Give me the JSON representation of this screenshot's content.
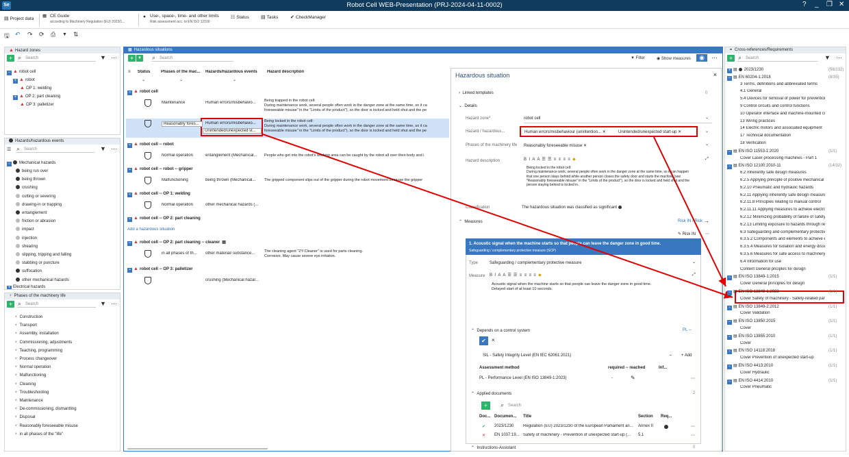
{
  "window": {
    "title": "Robot Cell WEB-Presentation (PRJ-2024-04-11-0002)",
    "logo": "Se",
    "controls": [
      "?",
      "_",
      "❐",
      "✕"
    ]
  },
  "ribbon": {
    "tabs": [
      {
        "label": "Project data",
        "sub": "",
        "icon": "project-icon"
      },
      {
        "label": "CE Guide",
        "sub": "according to Machinery Regulation (EU) 2023/1...",
        "icon": "ce-icon"
      },
      {
        "label": "Use-, space-, time- and other limits",
        "sub": "Risk assessment acc. to EN ISO 12100",
        "icon": "limits-icon"
      },
      {
        "label": "Status",
        "sub": "",
        "icon": "status-icon"
      },
      {
        "label": "Tasks",
        "sub": "",
        "icon": "tasks-icon"
      },
      {
        "label": "CheckManager",
        "sub": "",
        "icon": "check-icon"
      }
    ]
  },
  "hazard_zones": {
    "title": "Hazard zones",
    "search": "Search",
    "items": [
      {
        "label": "robot cell"
      },
      {
        "label": "robot"
      },
      {
        "label": "OP 1: welding"
      },
      {
        "label": "OP 2: part cleaning"
      },
      {
        "label": "OP 3: palletizer"
      }
    ]
  },
  "hazard_events": {
    "title": "Hazards/hazardous events",
    "search": "Search",
    "root": "Mechanical hazards",
    "items": [
      "being run over",
      "being thrown",
      "crushing",
      "cutting or severing",
      "drawing-in or trapping",
      "entanglement",
      "friction or abrasion",
      "impact",
      "injection",
      "shearing",
      "slipping, tripping and falling",
      "stabbing or puncture",
      "suffocation",
      "other mechanical hazards"
    ],
    "next": "Electrical hazards"
  },
  "phases": {
    "title": "Phases of the machinery life",
    "search": "Search",
    "items": [
      "Construction",
      "Transport",
      "Assembly,  installation",
      "Commissioning, adjustments",
      "Teaching, programming",
      "Process changeover",
      "Normal operation",
      "Malfunctioning",
      "Cleaning",
      "Troubleshooting",
      "Maintenance",
      "De-commissioning, dismantling",
      "Disposal",
      "Reasonably foreseeable misuse",
      "in all phases of the \"life\""
    ]
  },
  "situations": {
    "title": "Hazardous situations",
    "search": "Search",
    "filter": "Filter",
    "show_measures": "Show measures",
    "columns": [
      "Status",
      "Phases of the mac...",
      "Hazards/hazardous events",
      "Hazard description"
    ],
    "groups": [
      {
        "label": "robot cell"
      },
      {
        "label": "robot cell -- robot"
      },
      {
        "label": "robot cell -- robot -- gripper"
      },
      {
        "label": "robot cell -- OP 1: welding"
      },
      {
        "label": "robot cell -- OP 2: part cleaning"
      },
      {
        "label": "robot cell -- OP 2: part cleaning -- cleaner"
      },
      {
        "label": "robot cell -- OP 3: palletizer"
      }
    ],
    "rows": [
      {
        "phase": "Maintenance",
        "hazard": "Human errors/misbehavio...",
        "desc": [
          "Being trapped in the robot cell:",
          "During maintenance work, several people often work in the danger zone at the same time, so it ca",
          "foreseeable misuse\" in the \"Limits of the product\"), so the door is locked and held shut and the pe"
        ]
      },
      {
        "phase": "Reasonably fores...",
        "hazard": "Human errors/misbehavio...",
        "hazard2": "Unintended/unexpected st...",
        "desc": [
          "Being locked in the robot cell:",
          "During maintenance work, several people often work in the danger zone at the same time, so it ca",
          "foreseeable misuse\" in the \"Limits of the product\"), so the door is locked and held shut and the pe"
        ]
      },
      {
        "phase": "Normal operation",
        "hazard": "entanglement (Mechanical...",
        "desc": [
          "People who get into the robot's working area can be caught by the robot all over their body and i"
        ]
      },
      {
        "phase": "Malfunctioning",
        "hazard": "being thrown (Mechanical...",
        "desc": [
          "The gripped component slips out of the gripper during the robot movement because the gripper"
        ]
      },
      {
        "phase": "Normal operation",
        "hazard": "other mechanical hazards (...",
        "desc": []
      },
      {
        "phase": "in all phases of th...",
        "hazard": "other material/ substance...",
        "desc": [
          "The cleaning agent \"ZY-Cleaner\" is used for parts cleaning.",
          "Corrosive. May cause severe eye irritation."
        ]
      },
      {
        "phase": "",
        "hazard": "crushing (Mechanical hazar...",
        "desc": []
      }
    ],
    "add_link": "Add a hazardous situation"
  },
  "detail": {
    "title": "Hazardous situation",
    "linked": "Linked templates",
    "details": "Details",
    "zone_label": "Hazard zone*",
    "zone_value": "robot cell",
    "hazard_label": "Hazard / hazardous...",
    "hazard_chips": [
      "Human errors/misbehaviour (unintention...",
      "Unintended/unexpected start-up"
    ],
    "phase_label": "Phases of the machinery life",
    "phase_value": "Reasonably foreseeable misuse",
    "desc_label": "Hazard description",
    "desc_lines": [
      "Being locked in the robot cell:",
      "During maintenance work, several people often work in the danger zone at the same time, so it can happen",
      "that one person stays behind while another person closes the safety door and starts the machine (see",
      "\"Reasonably foreseeable misuse\" in the \"Limits of the product\"), so the door is locked and held shut and the",
      "person staying behind is locked in."
    ],
    "class_label": "Classification",
    "class_value": "The hazardous situation was classified as significant",
    "measures": "Measures",
    "risk_in": "Risk IN / Risk",
    "risk_btn": "Risk IN",
    "measure_title": "1. Acoustic signal when the machine starts so that people can leave the danger zone in good time.",
    "measure_sub": "Safeguarding / complementary protective measure (SCP)",
    "type_label": "Type",
    "type_value": "Safeguarding / complementary protective measure",
    "measure_label": "Measure",
    "measure_text": [
      "Acoustic signal when the machine starts so that people can leave the danger zone in good time.",
      "Delayed start of at least 10 seconds."
    ],
    "control_label": "Depends on a control system",
    "pl_badge": "PL --",
    "sil": "SIL - Safety Integrity Level (EN IEC 62061:2021)",
    "add": "Add",
    "assess_cols": [
      "Assessment method",
      "required -- reached",
      "Inf..."
    ],
    "assess_row": "PL - Performance Level (EN ISO 13849-1:2023)",
    "assess_req": "-",
    "applied_docs": "Applied documents",
    "applied_count": "2",
    "doc_search": "Search",
    "doc_cols": [
      "Doc...",
      "Documen...",
      "Title",
      "Section",
      "Req..."
    ],
    "docs": [
      {
        "doc": "2023/1230",
        "title": "Regulation (EU) 2023/1230 of the European Parliament an...",
        "section": "Annex II"
      },
      {
        "doc": "EN 1037:19...",
        "title": "Safety of machinery - Prevention of unexpected start-up (...",
        "section": "5.1"
      }
    ],
    "instructions": "Instructions-Assistant"
  },
  "xref": {
    "title": "Cross-references/Requirements",
    "search": "Search",
    "items": [
      {
        "label": "2023/1230",
        "count": "(58/132)",
        "subs": []
      },
      {
        "label": "EN 60204-1:2018",
        "count": "(8/35)",
        "subs": [
          "3 Terms, definitions and abbreviated terms",
          "4.1 General",
          "5.4 Devices for removal of power for prevention of u...",
          "9 Control circuits and control functions",
          "10 Operator interface and machine-mounted contro...",
          "13 Wiring practices",
          "14 Electric motors and associated equipment",
          "17 Technical documentation",
          "18 Verification"
        ]
      },
      {
        "label": "EN ISO 11553-1:2020",
        "count": "(1/1)",
        "subs": [
          "Cover Laser processing machines - Part 1"
        ]
      },
      {
        "label": "EN ISO 12100:2010-11",
        "count": "(14/32)",
        "subs": [
          "6.2 Inherently safe design measures",
          "6.2.5 Applying principle of positive mechanical action",
          "6.2.10 Pneumatic and hydraulic hazards",
          "6.2.11 Applying inherently safe design measures to c...",
          "6.2.11.8 Principles relating to manual control",
          "6.2.11.11 Applying measures to achieve electromagn...",
          "6.2.12 Minimizing probability of failure of safety fun...",
          "6.2.13 Limiting exposure to hazards through reliabili...",
          "6.3 Safeguarding and complementary protective me...",
          "6.3.5.2 Components and elements to achieve emerg...",
          "6.3.5.4 Measures for isolation and energy dissipation",
          "6.3.5.6 Measures for safe access to machinery",
          "6.4 Information for use",
          "Content General priciples for design"
        ]
      },
      {
        "label": "EN ISO 13849-1:2015",
        "count": "(1/1)",
        "subs": [
          "Cover General principles for design"
        ]
      },
      {
        "label": "EN ISO 13849-1:2023",
        "count": "(1/1)",
        "subs": [
          "Cover Safety of machinery - Safety-related parts of c..."
        ]
      },
      {
        "label": "EN ISO 13849-2:2012",
        "count": "(1/1)",
        "subs": [
          "Cover Validation"
        ]
      },
      {
        "label": "EN ISO 13850:2015",
        "count": "(1/1)",
        "subs": [
          "Cover"
        ]
      },
      {
        "label": "EN ISO 13855:2010",
        "count": "(1/1)",
        "subs": [
          "Cover"
        ]
      },
      {
        "label": "EN ISO 14118:2018",
        "count": "(1/1)",
        "subs": [
          "Cover Prevention of unexpected start-up"
        ]
      },
      {
        "label": "EN ISO 4413:2010",
        "count": "(1/1)",
        "subs": [
          "Cover Hydraulic"
        ]
      },
      {
        "label": "EN ISO 4414:2010",
        "count": "(1/1)",
        "subs": [
          "Cover Pneumatic"
        ]
      }
    ]
  },
  "colors": {
    "titlebar": "#0f3b5c",
    "accent": "#3a77c1",
    "green": "#2db36a",
    "annotation": "#e00000"
  }
}
